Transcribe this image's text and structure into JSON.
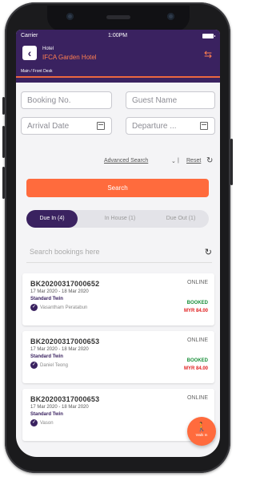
{
  "status": {
    "carrier": "Carrier",
    "time": "1:00PM"
  },
  "header": {
    "small_label": "Hotel",
    "hotel_name": "IFCA Garden Hotel",
    "breadcrumb": "Main / Front Desk"
  },
  "search": {
    "booking_no_placeholder": "Booking No.",
    "guest_name_placeholder": "Guest Name",
    "arrival_placeholder": "Arrival Date",
    "departure_placeholder": "Departure ...",
    "advanced_label": "Advanced Search",
    "caret": "⌄",
    "separator": "|",
    "reset_label": "Reset",
    "search_button": "Search",
    "list_placeholder": "Search bookings here"
  },
  "tabs": [
    {
      "label": "Due In (4)"
    },
    {
      "label": "In House (1)"
    },
    {
      "label": "Due Out (1)"
    }
  ],
  "bookings": [
    {
      "id": "BK20200317000652",
      "channel": "ONLINE",
      "dates": "17 Mar 2020 - 18 Mar 2020",
      "room": "Standard Twin",
      "guest": "Vasantham Peratabun",
      "status": "BOOKED",
      "amount": "MYR 84.00"
    },
    {
      "id": "BK20200317000653",
      "channel": "ONLINE",
      "dates": "17 Mar 2020 - 18 Mar 2020",
      "room": "Standard Twin",
      "guest": "Daniel Teong",
      "status": "BOOKED",
      "amount": "MYR 84.00"
    },
    {
      "id": "BK20200317000653",
      "channel": "ONLINE",
      "dates": "17 Mar 2020 - 18 Mar 2020",
      "room": "Standard Twin",
      "guest": "Vason",
      "status": "",
      "amount": ""
    }
  ],
  "fab": {
    "label": "Walk In"
  },
  "colors": {
    "primary": "#3a2260",
    "accent": "#ff6b3d",
    "booked": "#1a8f3a",
    "amount": "#e02020"
  },
  "icons": {
    "back": "chevron-left-icon",
    "swap": "swap-icon",
    "calendar": "calendar-icon",
    "refresh": "refresh-icon",
    "guest": "check-circle-icon",
    "walk_in": "walking-person-icon"
  }
}
